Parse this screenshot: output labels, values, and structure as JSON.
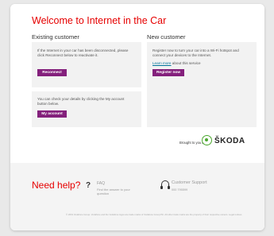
{
  "page": {
    "title": "Welcome to Internet in the Car"
  },
  "existing": {
    "heading": "Existing customer",
    "reconnect_text": "If the Internet in your car has been disconnected, please click Reconnect below to reactivate it.",
    "reconnect_label": "Reconnect",
    "account_text": "You can check your details by clicking the My account button below.",
    "account_label": "My account"
  },
  "new_customer": {
    "heading": "New customer",
    "register_text": "Register now to turn your car into a Wi-Fi hotspot and connect your devices to the Internet.",
    "learn_more": "Learn more",
    "about_text": " about this service",
    "register_label": "Register now"
  },
  "sponsor": {
    "brought_by": "Brought to you by",
    "logo_text": "ŠKODA",
    "logo_color": "#4ba82e"
  },
  "footer": {
    "need_help": "Need help?",
    "faq_title": "FAQ",
    "faq_sub": "Find the answer to your question",
    "cs_title": "Customer Support",
    "cs_number": "000 795599",
    "legal": "© 2019 Vodafone Group. Vodafone and the Vodafone logos are trade marks of Vodafone Group Plc. All other trade marks are the property of their respective owners. Legal notices"
  },
  "colors": {
    "brand_red": "#e60000",
    "button_purple": "#84207c",
    "link": "#00749b"
  }
}
